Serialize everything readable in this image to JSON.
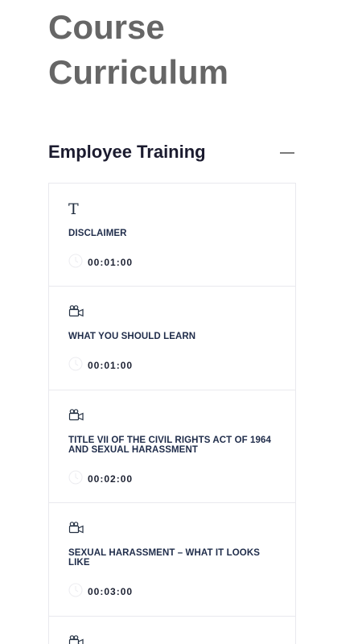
{
  "page": {
    "title": "Course Curriculum"
  },
  "section": {
    "title": "Employee Training",
    "toggle_icon": "minus-icon"
  },
  "lessons": [
    {
      "icon": "text-icon",
      "title": "DISCLAIMER",
      "duration": "00:01:00"
    },
    {
      "icon": "video-camera-icon",
      "title": "WHAT YOU SHOULD LEARN",
      "duration": "00:01:00"
    },
    {
      "icon": "video-camera-icon",
      "title": "TITLE VII OF THE CIVIL RIGHTS ACT OF 1964 AND SEXUAL HARASSMENT",
      "duration": "00:02:00"
    },
    {
      "icon": "video-camera-icon",
      "title": "SEXUAL HARASSMENT – WHAT IT LOOKS LIKE",
      "duration": "00:03:00"
    },
    {
      "icon": "video-camera-icon",
      "title": "",
      "duration": ""
    }
  ],
  "colors": {
    "title_gray": "#666666",
    "heading_dark": "#1b1b2f",
    "lesson_text": "#1f2c4a",
    "border": "#e9e9ee"
  }
}
